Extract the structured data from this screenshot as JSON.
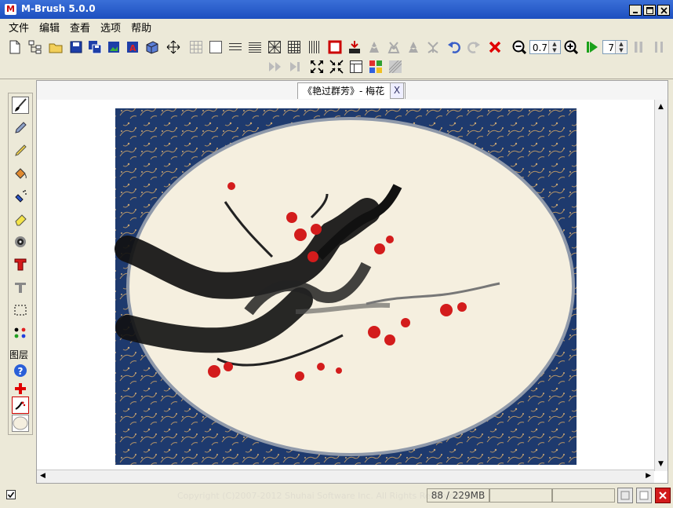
{
  "window": {
    "title": "M-Brush 5.0.0",
    "logo": "M"
  },
  "menu": [
    "文件",
    "编辑",
    "查看",
    "选项",
    "帮助"
  ],
  "toolbar": {
    "zoom_value": "0.7",
    "brush_size_value": "7"
  },
  "tab": {
    "label": "《艳过群芳》- 梅花",
    "close": "X"
  },
  "left_panel": {
    "layers_label": "图层"
  },
  "status": {
    "copyright": "Copyright (C)2007-2012 Shuhai Software Inc. All Rights Reserved.",
    "memory": "88 / 229MB"
  },
  "colors": {
    "accent_red": "#cc0000",
    "frame_blue": "#1e3a6e",
    "paper": "#f5efdf",
    "play_green": "#1aa11a"
  }
}
